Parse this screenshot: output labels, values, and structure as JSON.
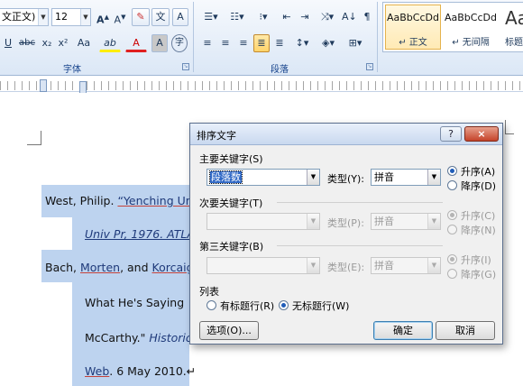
{
  "ribbon": {
    "font_name": "文正文)",
    "font_size": "12",
    "grow_font": "A",
    "shrink_font": "A",
    "phonetic_guide": "文",
    "char_border": "A",
    "strikethrough": "abc",
    "subscript": "x₂",
    "superscript": "x²",
    "change_case": "Aa",
    "highlight": "ab",
    "font_color": "A",
    "char_shading": "A",
    "enclose_char": "字",
    "font_group_label": "字体",
    "paragraph_group_label": "段落",
    "styles": [
      {
        "sample": "AaBbCcDd",
        "name": "↵ 正文"
      },
      {
        "sample": "AaBbCcDd",
        "name": "↵ 无间隔"
      },
      {
        "sample": "Aa",
        "name": "标题"
      }
    ]
  },
  "document": {
    "lines": [
      {
        "parts": [
          "West, Philip. ",
          "“Yenching Uni"
        ]
      },
      {
        "parts": [
          "Univ Pr, 1976. ATLA"
        ]
      },
      {
        "parts": [
          "Bach, ",
          "Morten",
          ", and ",
          "Korcaig"
        ]
      },
      {
        "parts": [
          "What  He's  Saying"
        ]
      },
      {
        "parts": [
          "McCarthy.\"  ",
          "Historic"
        ]
      },
      {
        "parts": [
          "Web",
          ". 6 May 2010.↵"
        ]
      }
    ]
  },
  "dialog": {
    "title": "排序文字",
    "help": "?",
    "close": "×",
    "primary_key_label": "主要关键字(S)",
    "primary_key_value": "段落数",
    "type_label_1": "类型(Y):",
    "type_value_1": "拼音",
    "ascending_1": "升序(A)",
    "descending_1": "降序(D)",
    "secondary_key_label": "次要关键字(T)",
    "type_label_2": "类型(P):",
    "type_value_2": "拼音",
    "ascending_2": "升序(C)",
    "descending_2": "降序(N)",
    "tertiary_key_label": "第三关键字(B)",
    "type_label_3": "类型(E):",
    "type_value_3": "拼音",
    "ascending_3": "升序(I)",
    "descending_3": "降序(G)",
    "list_label": "列表",
    "has_header": "有标题行(R)",
    "no_header": "无标题行(W)",
    "options_button": "选项(O)...",
    "ok_button": "确定",
    "cancel_button": "取消"
  }
}
